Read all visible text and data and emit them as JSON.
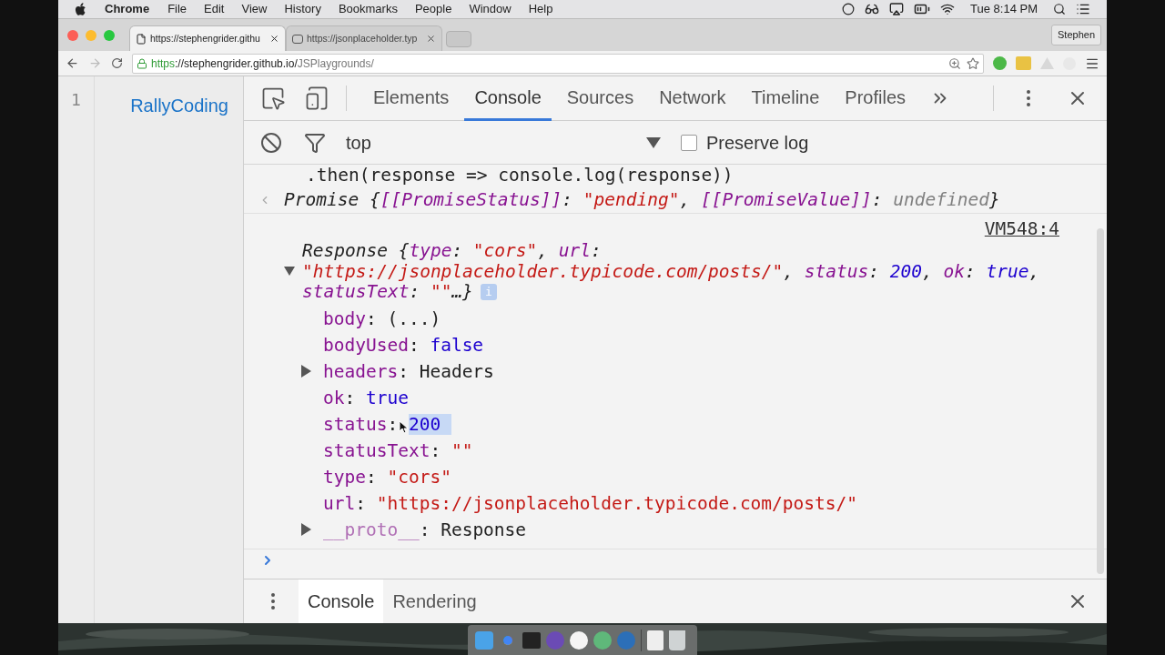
{
  "menu_bar": {
    "app": "Chrome",
    "items": [
      "File",
      "Edit",
      "View",
      "History",
      "Bookmarks",
      "People",
      "Window",
      "Help"
    ],
    "clock": "Tue 8:14 PM"
  },
  "browser_tabs": [
    {
      "title": "https://stephengrider.githu",
      "selected": true
    },
    {
      "title": "https://jsonplaceholder.typ",
      "selected": false
    }
  ],
  "profile": "Stephen",
  "address": {
    "scheme": "https",
    "host": "://stephengrider.github.io/",
    "path": "JSPlaygrounds/"
  },
  "editor": {
    "line_numbers": [
      "1"
    ],
    "preview_text": "RallyCoding"
  },
  "devtools": {
    "tabs": [
      {
        "label": "Elements",
        "selected": false
      },
      {
        "label": "Console",
        "selected": true
      },
      {
        "label": "Sources",
        "selected": false
      },
      {
        "label": "Network",
        "selected": false
      },
      {
        "label": "Timeline",
        "selected": false
      },
      {
        "label": "Profiles",
        "selected": false
      }
    ],
    "context": "top",
    "preserve_log": {
      "label": "Preserve log",
      "checked": false
    },
    "input_line": [
      {
        "text": ".then(response => console.log(response))",
        "kind": "plain"
      }
    ],
    "result_line": [
      {
        "text": "Promise {",
        "kind": "plain"
      },
      {
        "text": "[[PromiseStatus]]",
        "kind": "key"
      },
      {
        "text": ": ",
        "kind": "plain"
      },
      {
        "text": "\"pending\"",
        "kind": "string"
      },
      {
        "text": ", ",
        "kind": "plain"
      },
      {
        "text": "[[PromiseValue]]",
        "kind": "key"
      },
      {
        "text": ": ",
        "kind": "plain"
      },
      {
        "text": "undefined",
        "kind": "dim"
      },
      {
        "text": "}",
        "kind": "plain"
      }
    ],
    "source_link": "VM548:4",
    "logged_object": {
      "expanded": true,
      "badge": "i",
      "summary": [
        [
          {
            "text": "Response {",
            "kind": "plain"
          },
          {
            "text": "type",
            "kind": "key"
          },
          {
            "text": ": ",
            "kind": "plain"
          },
          {
            "text": "\"cors\"",
            "kind": "string"
          },
          {
            "text": ", ",
            "kind": "plain"
          },
          {
            "text": "url",
            "kind": "key"
          },
          {
            "text": ":",
            "kind": "plain"
          }
        ],
        [
          {
            "text": "\"https://jsonplaceholder.typicode.com/posts/\"",
            "kind": "string"
          },
          {
            "text": ", ",
            "kind": "plain"
          },
          {
            "text": "status",
            "kind": "key"
          },
          {
            "text": ": ",
            "kind": "plain"
          },
          {
            "text": "200",
            "kind": "number"
          },
          {
            "text": ", ",
            "kind": "plain"
          },
          {
            "text": "ok",
            "kind": "key"
          },
          {
            "text": ": ",
            "kind": "plain"
          },
          {
            "text": "true",
            "kind": "number"
          },
          {
            "text": ",",
            "kind": "plain"
          }
        ],
        [
          {
            "text": "statusText",
            "kind": "key"
          },
          {
            "text": ": ",
            "kind": "plain"
          },
          {
            "text": "\"\"",
            "kind": "string"
          },
          {
            "text": "…}",
            "kind": "plain"
          }
        ]
      ],
      "properties": [
        {
          "key": {
            "text": "body",
            "kind": "key"
          },
          "separator": ": ",
          "value": {
            "text": "(...)",
            "kind": "plain"
          },
          "expandable": false,
          "value_selected": false
        },
        {
          "key": {
            "text": "bodyUsed",
            "kind": "key"
          },
          "separator": ": ",
          "value": {
            "text": "false",
            "kind": "number"
          },
          "expandable": false,
          "value_selected": false
        },
        {
          "key": {
            "text": "headers",
            "kind": "key"
          },
          "separator": ": ",
          "value": {
            "text": "Headers",
            "kind": "plain"
          },
          "expandable": true,
          "value_selected": false
        },
        {
          "key": {
            "text": "ok",
            "kind": "key"
          },
          "separator": ": ",
          "value": {
            "text": "true",
            "kind": "number"
          },
          "expandable": false,
          "value_selected": false
        },
        {
          "key": {
            "text": "status",
            "kind": "key"
          },
          "separator": ": ",
          "value": {
            "text": "200",
            "kind": "number"
          },
          "expandable": false,
          "value_selected": true
        },
        {
          "key": {
            "text": "statusText",
            "kind": "key"
          },
          "separator": ": ",
          "value": {
            "text": "\"\"",
            "kind": "string"
          },
          "expandable": false,
          "value_selected": false
        },
        {
          "key": {
            "text": "type",
            "kind": "key"
          },
          "separator": ": ",
          "value": {
            "text": "\"cors\"",
            "kind": "string"
          },
          "expandable": false,
          "value_selected": false
        },
        {
          "key": {
            "text": "url",
            "kind": "key"
          },
          "separator": ": ",
          "value": {
            "text": "\"https://jsonplaceholder.typicode.com/posts/\"",
            "kind": "string"
          },
          "expandable": false,
          "value_selected": false
        },
        {
          "key": {
            "text": "__proto__",
            "kind": "internal"
          },
          "separator": ": ",
          "value": {
            "text": "Response",
            "kind": "plain"
          },
          "expandable": true,
          "value_selected": false
        }
      ]
    },
    "drawer_tabs": [
      {
        "label": "Console",
        "selected": true
      },
      {
        "label": "Rendering",
        "selected": false
      }
    ]
  }
}
